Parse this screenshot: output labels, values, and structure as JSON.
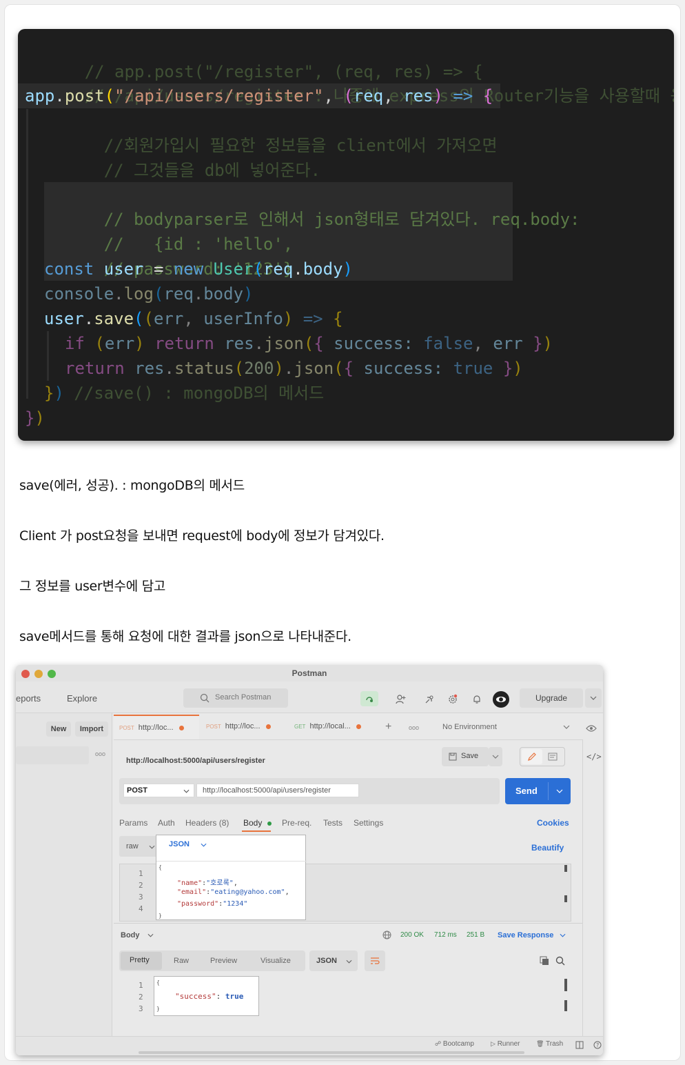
{
  "code": {
    "lines": {
      "l1": "// app.post(\"/register\", (req, res) => {",
      "l2": "// /api/users/register : 나중에 express의 Router기능을 사용할때 용이하다.",
      "l3_obj": "app",
      "l3_dot": ".",
      "l3_fn": "post",
      "l3_po": "(",
      "l3_str": "\"/api/users/register\"",
      "l3_comma": ", ",
      "l3_p2": "(",
      "l3_req": "req",
      "l3_c2": ", ",
      "l3_res": "res",
      "l3_p3": ")",
      "l3_arrow": " => ",
      "l3_brace": "{",
      "l4": "//회원가입시 필요한 정보들을 client에서 가져오면",
      "l5": "// 그것들을 db에 넣어준다.",
      "l7": "// bodyparser로 인해서 json형태로 담겨있다. req.body:",
      "l8": "//   {id : 'hello',",
      "l9": "// password: '123'}",
      "l10_const": "const",
      "l10_user": " user",
      "l10_eq": " = ",
      "l10_new": "new",
      "l10_cls": " User",
      "l10_po": "(",
      "l10_req": "req",
      "l10_dot": ".",
      "l10_body": "body",
      "l10_pc": ")",
      "l11_console": "console",
      "l11_dot": ".",
      "l11_log": "log",
      "l11_po": "(",
      "l11_req": "req",
      "l11_dot2": ".",
      "l11_body": "body",
      "l11_pc": ")",
      "l12_user": "user",
      "l12_dot": ".",
      "l12_save": "save",
      "l12_po": "(",
      "l12_p2": "(",
      "l12_err": "err",
      "l12_comma": ", ",
      "l12_info": "userInfo",
      "l12_p3": ")",
      "l12_arrow": " => ",
      "l12_brace": "{",
      "l13_if": "if",
      "l13_po": " (",
      "l13_err": "err",
      "l13_pc": ")",
      "l13_ret": " return",
      "l13_res": " res",
      "l13_dot": ".",
      "l13_json": "json",
      "l13_po2": "(",
      "l13_ob": "{",
      "l13_succ": " success",
      "l13_colon": ": ",
      "l13_false": "false",
      "l13_comma": ", ",
      "l13_err2": "err",
      "l13_cb": " }",
      "l13_pc2": ")",
      "l14_ret": "return",
      "l14_res": " res",
      "l14_dot": ".",
      "l14_status": "status",
      "l14_po": "(",
      "l14_num": "200",
      "l14_pc": ")",
      "l14_dot2": ".",
      "l14_json": "json",
      "l14_po2": "(",
      "l14_ob": "{",
      "l14_succ": " success",
      "l14_colon": ": ",
      "l14_true": "true",
      "l14_cb": " }",
      "l14_pc2": ")",
      "l15_cb": "}",
      "l15_pc": ")",
      "l15_cm": " //save() : mongoDB의 메서드",
      "l16_cb": "}",
      "l16_pc": ")"
    }
  },
  "paragraphs": {
    "p1": "save(에러, 성공). : mongoDB의 메서드",
    "p2": "Client 가 post요청을 보내면 request에 body에 정보가 담겨있다.",
    "p3": "그 정보를 user변수에 담고",
    "p4": "save메서드를 통해 요청에 대한 결과를 json으로 나타내준다."
  },
  "postman": {
    "window_title": "Postman",
    "nav": {
      "reports": "eports",
      "explore": "Explore"
    },
    "search_placeholder": "Search Postman",
    "upgrade": "Upgrade",
    "sidebar": {
      "new": "New",
      "import": "Import",
      "more": "ooo"
    },
    "tabs": [
      {
        "method": "POST",
        "label": "http://loc..."
      },
      {
        "method": "POST",
        "label": "http://loc..."
      },
      {
        "method": "GET",
        "label": "http://local..."
      }
    ],
    "tab_add": "+",
    "tab_more": "ooo",
    "environment": "No Environment",
    "request_title": "http://localhost:5000/api/users/register",
    "save": "Save",
    "method": "POST",
    "url": "http://localhost:5000/api/users/register",
    "send": "Send",
    "request_tabs": {
      "params": "Params",
      "auth": "Auth",
      "headers": "Headers (8)",
      "body": "Body",
      "prereq": "Pre-req.",
      "tests": "Tests",
      "settings": "Settings"
    },
    "cookies": "Cookies",
    "body_type": "raw",
    "body_format": "JSON",
    "beautify": "Beautify",
    "request_body": {
      "ln1": "1",
      "ln2": "2",
      "ln3": "3",
      "ln4": "4",
      "open": "{",
      "k_name": "\"name\"",
      "v_name": "\"호로록\"",
      "k_email": "\"email\"",
      "v_email": "\"eating@yahoo.com\"",
      "k_password": "\"password\"",
      "v_password": "\"1234\"",
      "colon": ":",
      "comma": ",",
      "close": "}"
    },
    "response": {
      "label": "Body",
      "status": "200 OK",
      "time": "712 ms",
      "size": "251 B",
      "save_response": "Save Response",
      "view_tabs": {
        "pretty": "Pretty",
        "raw": "Raw",
        "preview": "Preview",
        "visualize": "Visualize"
      },
      "format": "JSON",
      "ln1": "1",
      "ln2": "2",
      "ln3": "3",
      "open": "{",
      "k_success": "\"success\"",
      "colon": ":",
      "v_success": "true",
      "close": "}"
    },
    "footer": {
      "bootcamp": "Bootcamp",
      "runner": "Runner",
      "trash": "Trash"
    }
  },
  "colors": {
    "code_bg": "#1e1e1e",
    "send_button": "#2b6fd6",
    "status_dot": "#e8733c",
    "body_tab_dot": "#2e9a46"
  }
}
